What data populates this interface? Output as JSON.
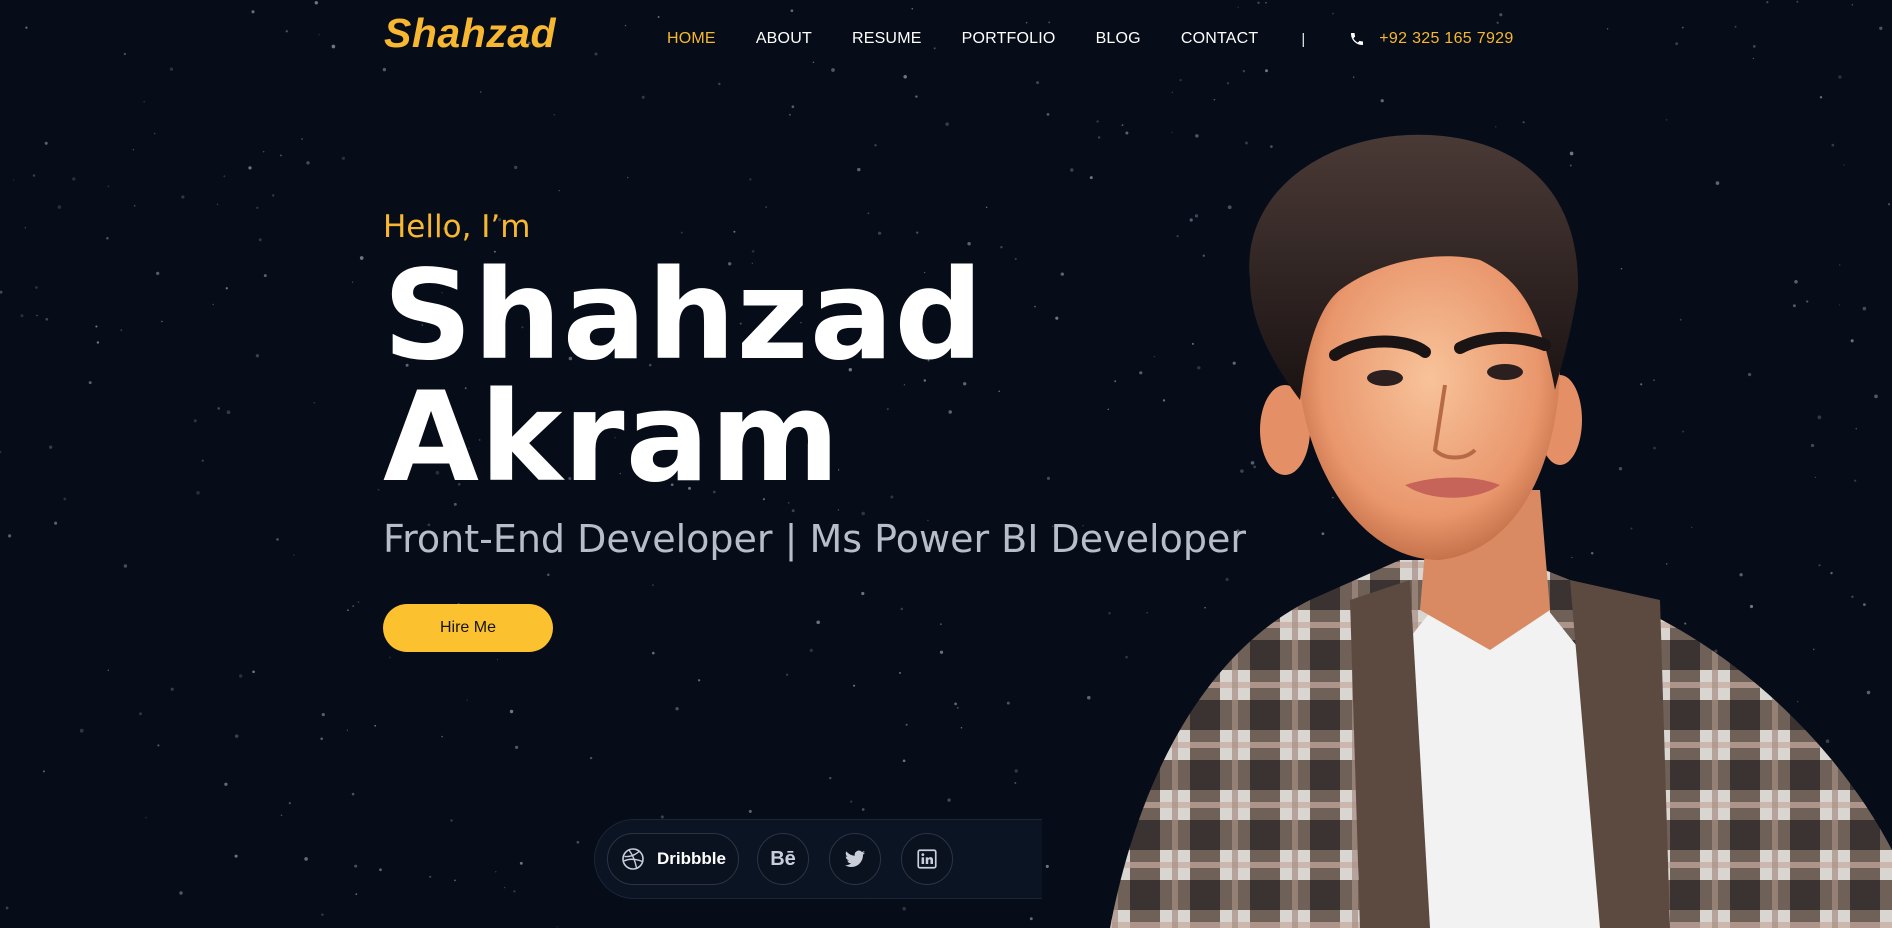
{
  "colors": {
    "background": "#060c18",
    "accent": "#f7b730",
    "button": "#fcc12f",
    "muted_text": "#b8bec9"
  },
  "header": {
    "logo": "Shahzad",
    "nav": [
      {
        "label": "HOME",
        "active": true
      },
      {
        "label": "ABOUT",
        "active": false
      },
      {
        "label": "RESUME",
        "active": false
      },
      {
        "label": "PORTFOLIO",
        "active": false
      },
      {
        "label": "BLOG",
        "active": false
      },
      {
        "label": "CONTACT",
        "active": false
      }
    ],
    "separator": "|",
    "phone_icon": "phone-icon",
    "phone": "+92 325 165 7929"
  },
  "hero": {
    "greeting": "Hello, I’m",
    "name_line1": "Shahzad",
    "name_line2": "Akram",
    "role": "Front-End Developer | Ms Power BI Developer",
    "cta": "Hire Me"
  },
  "social": {
    "dribbble": {
      "icon": "dribbble-icon",
      "label": "Dribbble"
    },
    "behance": {
      "icon": "behance-icon",
      "label": "Bē"
    },
    "twitter": {
      "icon": "twitter-icon"
    },
    "linkedin": {
      "icon": "linkedin-icon"
    }
  },
  "portrait": {
    "icon": "cartoon-portrait-image"
  }
}
